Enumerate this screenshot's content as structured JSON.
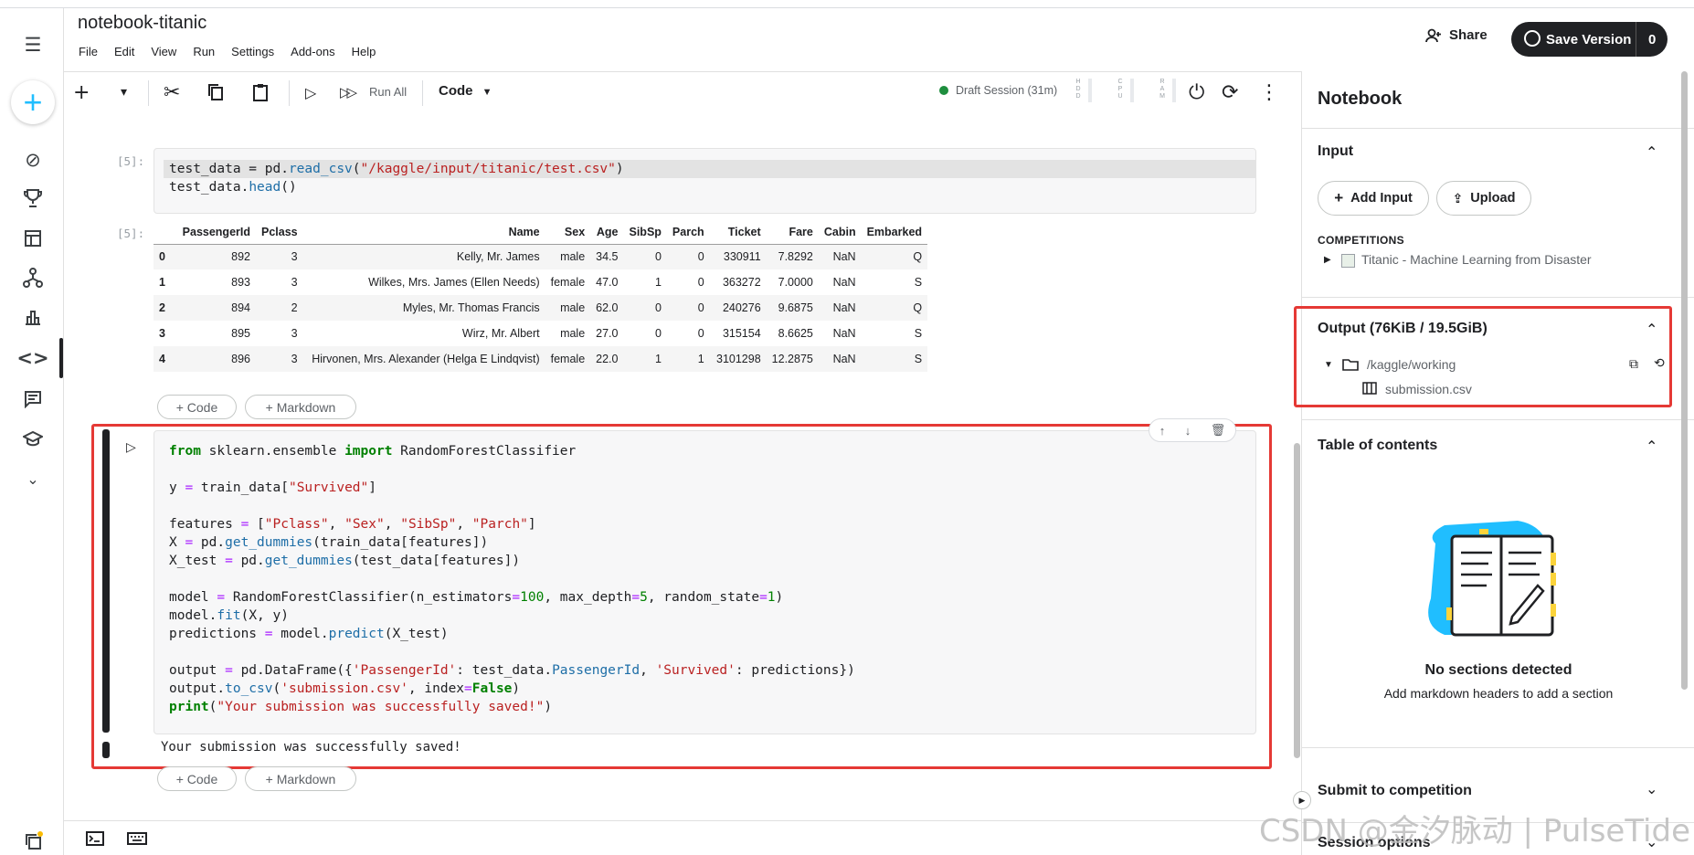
{
  "notebook": {
    "title": "notebook-titanic"
  },
  "menu": [
    "File",
    "Edit",
    "View",
    "Run",
    "Settings",
    "Add-ons",
    "Help"
  ],
  "header": {
    "share_label": "Share",
    "save_version_label": "Save Version",
    "save_version_count": "0"
  },
  "toolbar": {
    "run_all_label": "Run All",
    "cell_type": "Code",
    "session_status": "Draft Session (31m)",
    "meters": [
      {
        "label": "HDD"
      },
      {
        "label": "CPU"
      },
      {
        "label": "RAM"
      }
    ]
  },
  "cells": [
    {
      "prompt": "[5]:",
      "code_lines": [
        "test_data = pd.read_csv(\"/kaggle/input/titanic/test.csv\")",
        "test_data.head()"
      ],
      "output_prompt": "[5]:",
      "table": {
        "columns": [
          "",
          "PassengerId",
          "Pclass",
          "Name",
          "Sex",
          "Age",
          "SibSp",
          "Parch",
          "Ticket",
          "Fare",
          "Cabin",
          "Embarked"
        ],
        "rows": [
          [
            "0",
            "892",
            "3",
            "Kelly, Mr. James",
            "male",
            "34.5",
            "0",
            "0",
            "330911",
            "7.8292",
            "NaN",
            "Q"
          ],
          [
            "1",
            "893",
            "3",
            "Wilkes, Mrs. James (Ellen Needs)",
            "female",
            "47.0",
            "1",
            "0",
            "363272",
            "7.0000",
            "NaN",
            "S"
          ],
          [
            "2",
            "894",
            "2",
            "Myles, Mr. Thomas Francis",
            "male",
            "62.0",
            "0",
            "0",
            "240276",
            "9.6875",
            "NaN",
            "Q"
          ],
          [
            "3",
            "895",
            "3",
            "Wirz, Mr. Albert",
            "male",
            "27.0",
            "0",
            "0",
            "315154",
            "8.6625",
            "NaN",
            "S"
          ],
          [
            "4",
            "896",
            "3",
            "Hirvonen, Mrs. Alexander (Helga E Lindqvist)",
            "female",
            "22.0",
            "1",
            "1",
            "3101298",
            "12.2875",
            "NaN",
            "S"
          ]
        ]
      }
    },
    {
      "output_text": "Your submission was successfully saved!"
    }
  ],
  "add_cell": {
    "code_label": "+ Code",
    "markdown_label": "+ Markdown"
  },
  "panel": {
    "title": "Notebook",
    "input": {
      "header": "Input",
      "add_input_label": "Add Input",
      "upload_label": "Upload",
      "competitions_label": "COMPETITIONS",
      "competition_name": "Titanic - Machine Learning from Disaster"
    },
    "output": {
      "header": "Output (76KiB / 19.5GiB)",
      "folder": "/kaggle/working",
      "file": "submission.csv"
    },
    "toc": {
      "header": "Table of contents",
      "empty_title": "No sections detected",
      "empty_subtitle": "Add markdown headers to add a section"
    },
    "submit": {
      "header": "Submit to competition"
    },
    "session_options": {
      "header": "Session options"
    }
  },
  "watermark": "CSDN @金汐脉动 | PulseTide",
  "colors": {
    "accent": "#20beff",
    "highlight": "#e53935",
    "session_dot": "#1e8e3e",
    "dark_button": "#202124"
  }
}
